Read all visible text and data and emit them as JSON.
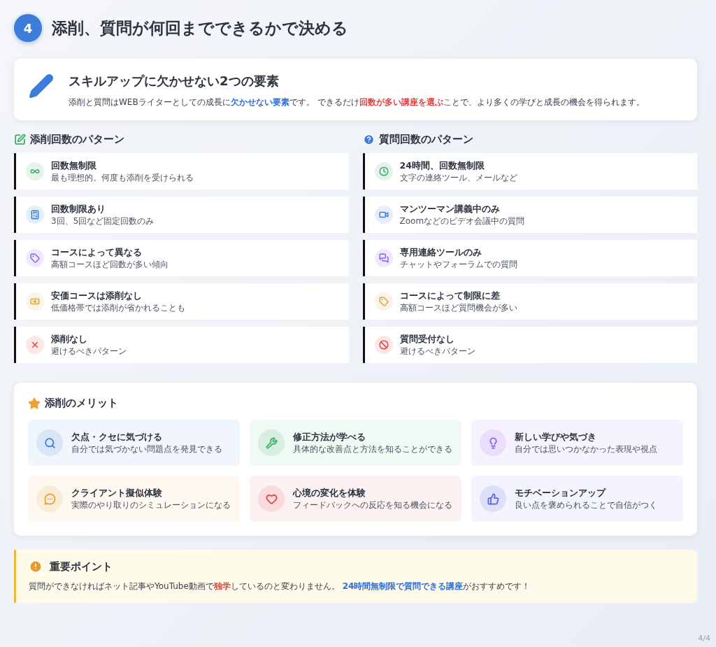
{
  "header": {
    "number": "4",
    "title": "添削、質問が何回までできるかで決める"
  },
  "intro": {
    "title": "スキルアップに欠かせない2つの要素",
    "text": [
      {
        "kind": "plain",
        "text": "添削と質問はWEBライターとしての成長に"
      },
      {
        "kind": "accent",
        "text": "欠かせない要素"
      },
      {
        "kind": "plain",
        "text": "です。 できるだけ"
      },
      {
        "kind": "warn",
        "text": "回数が多い講座を選ぶ"
      },
      {
        "kind": "plain",
        "text": "ことで、より多くの学びと成長の機会を得られます。"
      }
    ]
  },
  "columns": [
    {
      "heading": "添削回数のパターン",
      "items": [
        {
          "title": "回数無制限",
          "note": "最も理想的。何度も添削を受けられる",
          "color": "#3fae6a"
        },
        {
          "title": "回数制限あり",
          "note": "3回、5回など固定回数のみ",
          "color": "#3b7dd8"
        },
        {
          "title": "コースによって異なる",
          "note": "高額コースほど回数が多い傾向",
          "color": "#8b5cf6"
        },
        {
          "title": "安価コースは添削なし",
          "note": "低価格帯では添削が省かれることも",
          "color": "#e0a43a"
        },
        {
          "title": "添削なし",
          "note": "避けるべきパターン",
          "color": "#e04848"
        }
      ]
    },
    {
      "heading": "質問回数のパターン",
      "items": [
        {
          "title": "24時間、回数無制限",
          "note": "文字の連絡ツール、メールなど",
          "color": "#3fae6a"
        },
        {
          "title": "マンツーマン講義中のみ",
          "note": "Zoomなどのビデオ会議中の質問",
          "color": "#3b7dd8"
        },
        {
          "title": "専用連絡ツールのみ",
          "note": "チャットやフォーラムでの質問",
          "color": "#8b5cf6"
        },
        {
          "title": "コースによって制限に差",
          "note": "高額コースほど質問機会が多い",
          "color": "#e0a43a"
        },
        {
          "title": "質問受付なし",
          "note": "避けるべきパターン",
          "color": "#e04848"
        }
      ]
    }
  ],
  "merits": {
    "heading": "添削のメリット",
    "items": [
      {
        "title": "欠点・クセに気づける",
        "note": "自分では気づかない問題点を発見できる",
        "color": "#3b7dd8"
      },
      {
        "title": "修正方法が学べる",
        "note": "具体的な改善点と方法を知ることができる",
        "color": "#3fae6a"
      },
      {
        "title": "新しい学びや気づき",
        "note": "自分では思いつかなかった表現や視点",
        "color": "#8b5cf6"
      },
      {
        "title": "クライアント擬似体験",
        "note": "実際のやり取りのシミュレーションになる",
        "color": "#e0a43a"
      },
      {
        "title": "心境の変化を体験",
        "note": "フィードバックへの反応を知る機会になる",
        "color": "#e04848"
      },
      {
        "title": "モチベーションアップ",
        "note": "良い点を褒められることで自信がつく",
        "color": "#5b62e0"
      }
    ]
  },
  "important": {
    "title": "重要ポイント",
    "text": [
      {
        "kind": "plain",
        "text": "質問ができなければネット記事やYouTube動画で"
      },
      {
        "kind": "warn",
        "text": "独学"
      },
      {
        "kind": "plain",
        "text": "しているのと変わりません。 "
      },
      {
        "kind": "accent",
        "text": "24時間無制限で質問できる講座"
      },
      {
        "kind": "plain",
        "text": "がおすすめです！"
      }
    ]
  },
  "page_number": "4/4"
}
